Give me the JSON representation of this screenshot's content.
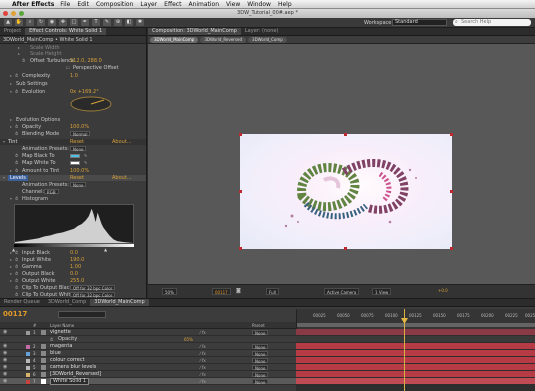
{
  "menubar": {
    "app": "After Effects",
    "items": [
      "File",
      "Edit",
      "Composition",
      "Layer",
      "Effect",
      "Animation",
      "View",
      "Window",
      "Help"
    ]
  },
  "window": {
    "title": "3DW_Tutorial_00#.aep *"
  },
  "toolbar": {
    "workspace_label": "Workspace:",
    "workspace_value": "Standard",
    "search_placeholder": "Search Help"
  },
  "left_panel": {
    "tabs": [
      "Project",
      "Effect Controls: White Solid 1"
    ],
    "header": "3DWorld_MainComp • White Solid 1",
    "props": [
      {
        "label": "Scale Width",
        "value": ""
      },
      {
        "label": "Scale Height",
        "value": ""
      },
      {
        "label": "Offset Turbulence",
        "value": "512.0, 288.0"
      },
      {
        "label": "Perspective Offset",
        "value": ""
      },
      {
        "label": "Complexity",
        "value": "1.0"
      },
      {
        "label": "Sub Settings",
        "value": ""
      },
      {
        "label": "Evolution",
        "value": "0x +169.2°"
      },
      {
        "label": "Evolution Options",
        "value": ""
      },
      {
        "label": "Opacity",
        "value": "100.0%"
      },
      {
        "label": "Blending Mode",
        "value": "Normal"
      },
      {
        "label": "Tint",
        "value": "Reset"
      },
      {
        "label": "Animation Presets:",
        "value": "None"
      },
      {
        "label": "Map Black To",
        "value": ""
      },
      {
        "label": "Map White To",
        "value": ""
      },
      {
        "label": "Amount to Tint",
        "value": "100.0%"
      },
      {
        "label": "Levels",
        "value": "Reset"
      },
      {
        "label": "Animation Presets:",
        "value": "None"
      },
      {
        "label": "Channel:",
        "value": "RGB"
      },
      {
        "label": "Histogram",
        "value": ""
      },
      {
        "label": "Input Black",
        "value": "0.0"
      },
      {
        "label": "Input White",
        "value": "190.0"
      },
      {
        "label": "Gamma",
        "value": "1.00"
      },
      {
        "label": "Output Black",
        "value": "0.0"
      },
      {
        "label": "Output White",
        "value": "255.0"
      },
      {
        "label": "Clip To Output Black",
        "value": "Off for 32 bpc Color"
      },
      {
        "label": "Clip To Output White",
        "value": "Off for 32 bpc Color"
      }
    ],
    "about": "About...",
    "colors": {
      "map_black": "#4fc0e8",
      "map_white": "#ffffff"
    }
  },
  "comp_panel": {
    "tabs": [
      "Composition: 3DWorld_MainComp",
      "Layer: (none)"
    ],
    "subtabs": [
      "3DWorld_MainComp",
      "3DWorld_Reversed",
      "3DWorld_Comp"
    ],
    "viewer": {
      "zoom": "50%",
      "timecode": "00117",
      "resolution": "Full",
      "camera": "Active Camera",
      "views": "1 View",
      "exposure": "+0.0"
    }
  },
  "timeline": {
    "tabs": [
      "Render Queue",
      "3DWorld_Comp",
      "3DWorld_MainComp"
    ],
    "current_time": "00117",
    "columns": [
      "#",
      "Layer Name",
      "Parent"
    ],
    "ruler": [
      "00025",
      "00050",
      "00075",
      "00100",
      "00125",
      "00150",
      "00175",
      "00200",
      "00225",
      "0025"
    ],
    "layers": [
      {
        "num": "1",
        "name": "vignette",
        "label_color": "#9a9a9a",
        "parent": "None"
      },
      {
        "num": "",
        "name": "Opacity",
        "value": "65%",
        "sub": true
      },
      {
        "num": "2",
        "name": "magenta",
        "label_color": "#c26da8",
        "parent": "None"
      },
      {
        "num": "3",
        "name": "blue",
        "label_color": "#6aa0d8",
        "parent": "None"
      },
      {
        "num": "4",
        "name": "colour correct",
        "label_color": "#b8b8b8",
        "parent": "None"
      },
      {
        "num": "5",
        "name": "camera blur levels",
        "label_color": "#b8b8b8",
        "parent": "None"
      },
      {
        "num": "6",
        "name": "[3DWorld_Reversed]",
        "label_color": "#d8b16a",
        "parent": "None"
      },
      {
        "num": "7",
        "name": "White Solid 1",
        "label_color": "#c8423e",
        "parent": "None"
      }
    ]
  }
}
